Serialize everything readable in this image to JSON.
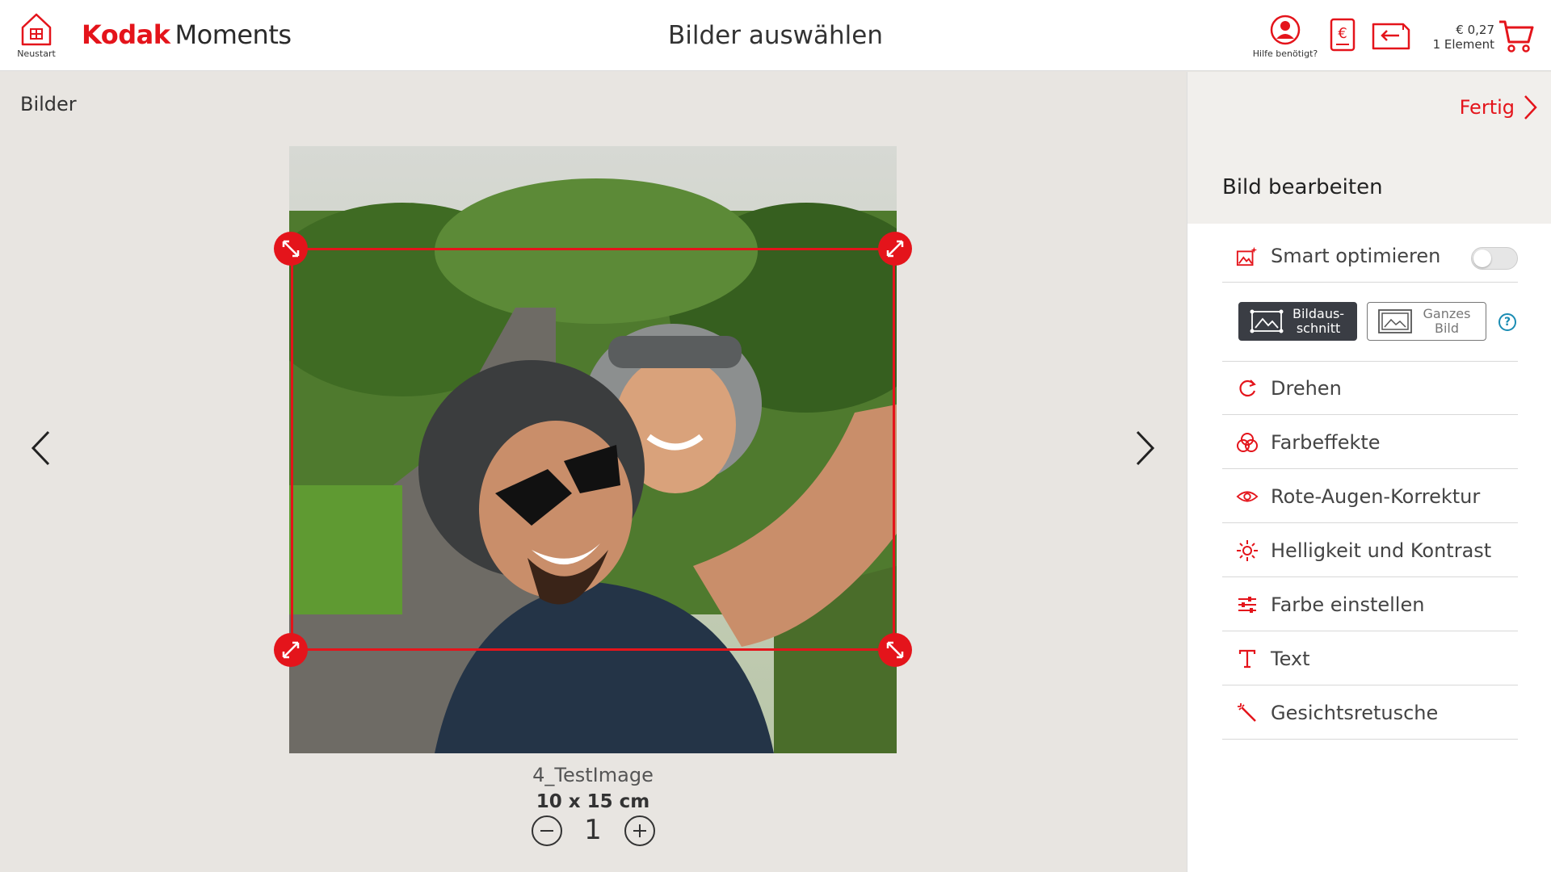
{
  "header": {
    "home_label": "Neustart",
    "brand_kodak": "Kodak",
    "brand_moments": "Moments",
    "title": "Bilder auswählen",
    "help_label": "Hilfe benötigt?",
    "price": "€ 0,27",
    "items": "1 Element"
  },
  "main": {
    "section_label": "Bilder",
    "image_name": "4_TestImage",
    "image_size": "10 x 15 cm",
    "quantity": "1"
  },
  "panel": {
    "done_label": "Fertig",
    "title": "Bild bearbeiten",
    "smart_optimize": "Smart optimieren",
    "smart_optimize_on": false,
    "crop_modes": [
      {
        "label_line1": "Bildaus-",
        "label_line2": "schnitt",
        "selected": true
      },
      {
        "label_line1": "Ganzes",
        "label_line2": "Bild",
        "selected": false
      }
    ],
    "help_symbol": "?",
    "tools": [
      {
        "label": "Drehen",
        "icon": "rotate-icon"
      },
      {
        "label": "Farbeffekte",
        "icon": "color-effects-icon"
      },
      {
        "label": "Rote-Augen-Korrektur",
        "icon": "eye-icon"
      },
      {
        "label": "Helligkeit und Kontrast",
        "icon": "brightness-icon"
      },
      {
        "label": "Farbe einstellen",
        "icon": "sliders-icon"
      },
      {
        "label": "Text",
        "icon": "text-icon"
      },
      {
        "label": "Gesichtsretusche",
        "icon": "magic-wand-icon"
      }
    ]
  },
  "colors": {
    "brand_red": "#e4141b",
    "selected_mode_bg": "#3a3d44",
    "help_blue": "#1a8cb3",
    "canvas_bg": "#e8e5e1"
  }
}
